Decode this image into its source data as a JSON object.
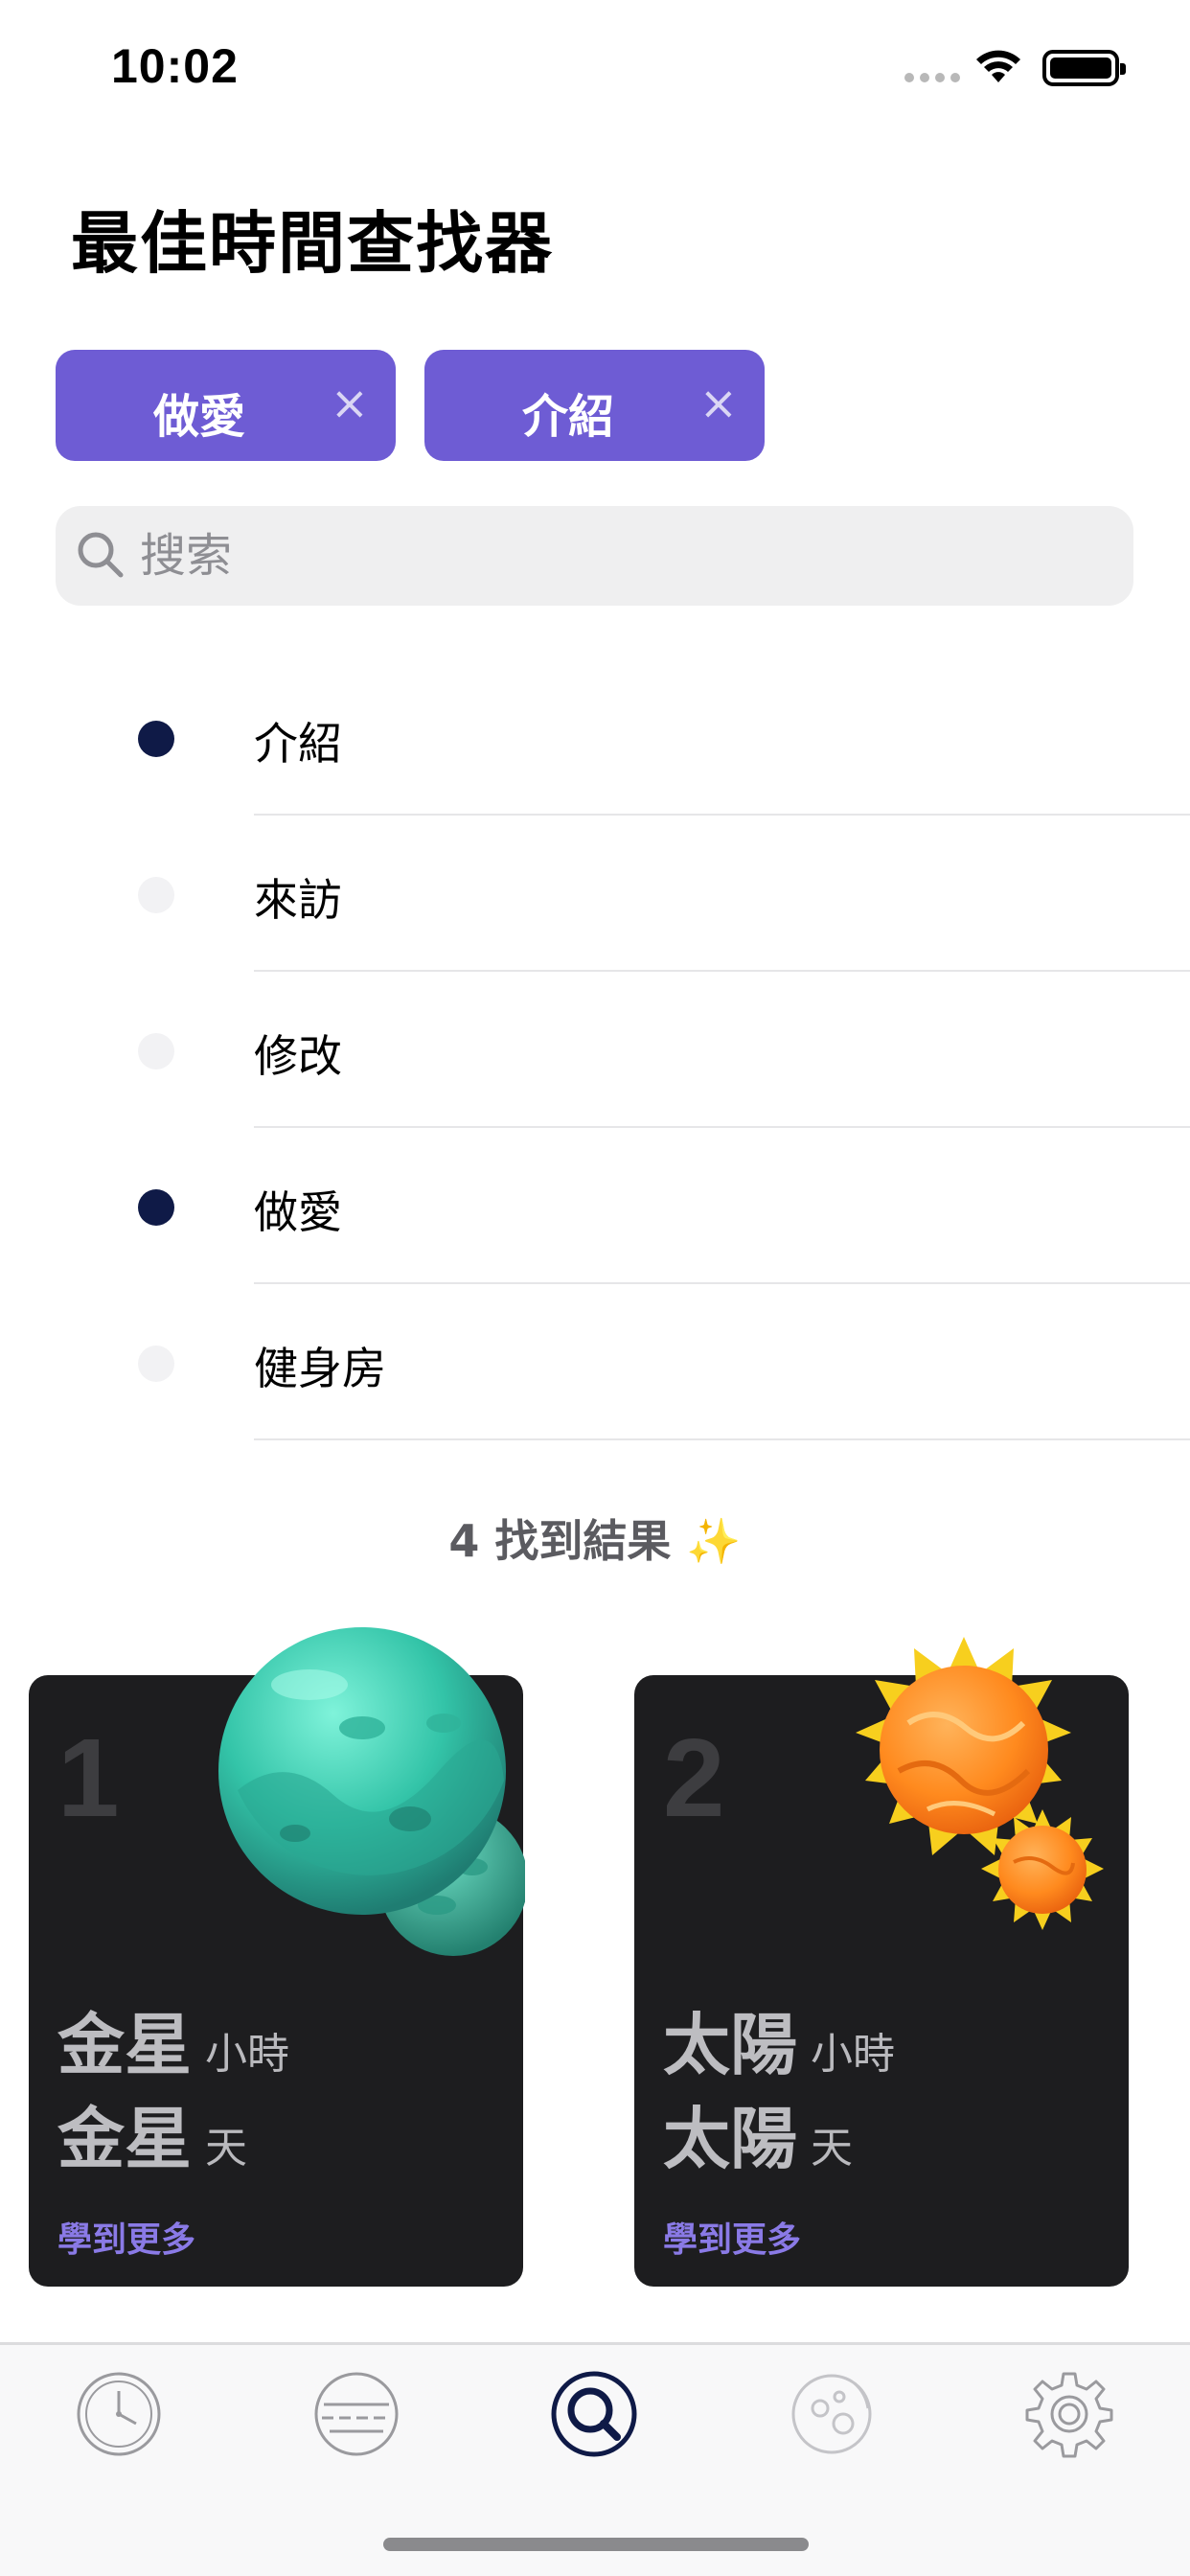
{
  "status_bar": {
    "time": "10:02"
  },
  "page_title": "最佳時間查找器",
  "chips": [
    {
      "label": "做愛",
      "close": "×"
    },
    {
      "label": "介紹",
      "close": "×"
    }
  ],
  "search": {
    "placeholder": "搜索",
    "value": ""
  },
  "options": [
    {
      "label": "介紹",
      "selected": true
    },
    {
      "label": "來訪",
      "selected": false
    },
    {
      "label": "修改",
      "selected": false
    },
    {
      "label": "做愛",
      "selected": true
    },
    {
      "label": "健身房",
      "selected": false
    }
  ],
  "results": {
    "text": "4 找到結果 ✨"
  },
  "cards": [
    {
      "rank": "1",
      "hour_planet": "金星",
      "hour_unit": "小時",
      "day_planet": "金星",
      "day_unit": "天",
      "learn_more": "學到更多",
      "planet_icon": "venus-planet-icon"
    },
    {
      "rank": "2",
      "hour_planet": "太陽",
      "hour_unit": "小時",
      "day_planet": "太陽",
      "day_unit": "天",
      "learn_more": "學到更多",
      "planet_icon": "sun-planet-icon"
    }
  ],
  "tab_bar": {
    "active_index": 2,
    "tabs": [
      {
        "icon": "clock-icon"
      },
      {
        "icon": "planet-list-icon"
      },
      {
        "icon": "search-icon"
      },
      {
        "icon": "moon-icon"
      },
      {
        "icon": "gear-icon"
      }
    ]
  },
  "colors": {
    "accent": "#6e5cd4",
    "selected_dot": "#0f1a47",
    "card_bg": "#1d1d1f"
  }
}
